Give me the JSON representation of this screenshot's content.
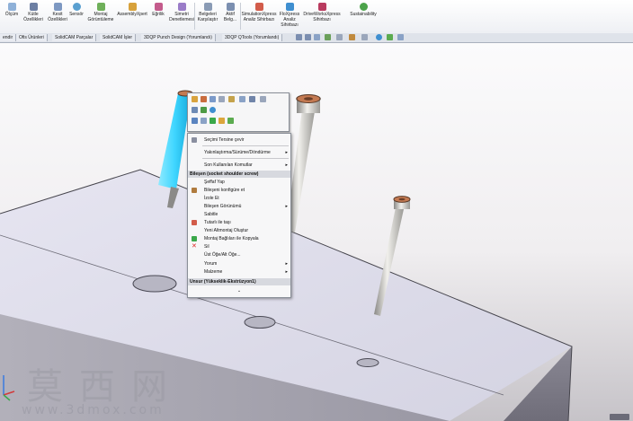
{
  "ribbon": {
    "items": [
      {
        "label": "Ölçüm",
        "icon": "measure-icon"
      },
      {
        "label": "Kütle Özellikleri",
        "icon": "mass-properties-icon"
      },
      {
        "label": "Kesit Özellikleri",
        "icon": "section-properties-icon"
      },
      {
        "label": "Sensör",
        "icon": "sensor-icon"
      },
      {
        "label": "Montaj Görüntüleme",
        "icon": "assembly-visualization-icon"
      },
      {
        "label": "AssemblyXpert",
        "icon": "assemblyxpert-icon"
      },
      {
        "label": "Eğrilik",
        "icon": "curvature-icon"
      },
      {
        "label": "Simetri Denetlemesi",
        "icon": "symmetry-check-icon"
      },
      {
        "label": "Belgeleri Karşılaştır",
        "icon": "compare-documents-icon"
      },
      {
        "label": "Aktif Belg...",
        "icon": "check-active-document-icon"
      },
      {
        "label": "SimulationXpress Analiz Sihirbazı",
        "icon": "simulationxpress-icon"
      },
      {
        "label": "FloXpress Analiz Sihirbazı",
        "icon": "floxpress-icon"
      },
      {
        "label": "DriveWorksXpress Sihirbazı",
        "icon": "driveworksxpress-icon"
      },
      {
        "label": "Sustainability",
        "icon": "sustainability-icon"
      }
    ]
  },
  "tabs": [
    {
      "label": "endir"
    },
    {
      "label": "Ofis Ürünleri"
    },
    {
      "label": "SolidCAM Parçalar"
    },
    {
      "label": "SolidCAM İşler"
    },
    {
      "label": "3DQP Punch Design (Yorumlandı)"
    },
    {
      "label": "3DQP QTools (Yorumlandı)"
    }
  ],
  "context_menu": {
    "items": [
      {
        "label": "Seçimi Tersine çevir"
      },
      {
        "label": "Yakınlaştırma/Sürüme/Döndürme",
        "submenu": true
      },
      {
        "label": "Son Kullanılan Komutlar",
        "submenu": true
      },
      {
        "label": "Şeffaf Yap"
      },
      {
        "label": "Bileşeni konfigüre et"
      },
      {
        "label": "İzole Et"
      },
      {
        "label": "Bileşen Görünümü",
        "submenu": true
      },
      {
        "label": "Sabitle"
      },
      {
        "label": "Tutarlı ile taşı"
      },
      {
        "label": "Yeni Altmontaj Oluştur"
      },
      {
        "label": "Montaj Bağlıları ile Kopyala"
      },
      {
        "label": "Sil"
      },
      {
        "label": "Üst Öğe/Alt Öğe...",
        "submenu": true
      },
      {
        "label": "Yorum",
        "submenu": true
      },
      {
        "label": "Malzeme",
        "submenu": true
      }
    ],
    "section_component": "Bileşen (socket shoulder screw)",
    "section_feature": "Unsur (Yükseklik-Ekstrüzyon1)",
    "more_chevron": "⌄"
  },
  "watermark": {
    "chinese": "莫西网",
    "url": "www.3dmox.com"
  },
  "colors": {
    "accent_red": "#b31b1b",
    "selection_cyan": "#3fd6ff",
    "block_top": "#e2e2ef",
    "block_front": "#a8a6b0",
    "menu_header": "#d7d9df"
  }
}
